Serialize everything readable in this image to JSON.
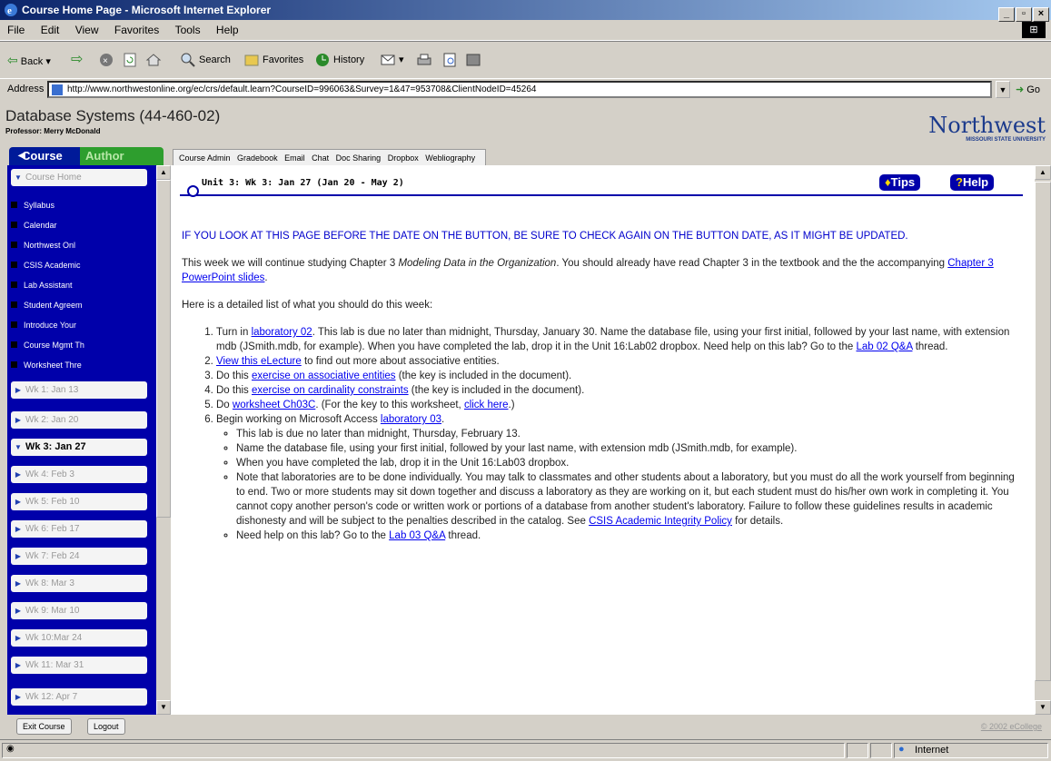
{
  "window": {
    "title": "Course Home Page - Microsoft Internet Explorer"
  },
  "menu": [
    "File",
    "Edit",
    "View",
    "Favorites",
    "Tools",
    "Help"
  ],
  "toolbar": {
    "back": "Back",
    "search": "Search",
    "favorites": "Favorites",
    "history": "History"
  },
  "address": {
    "label": "Address",
    "url": "http://www.northwestonline.org/ec/crs/default.learn?CourseID=996063&Survey=1&47=953708&ClientNodeID=45264",
    "go": "Go"
  },
  "course": {
    "title": "Database Systems (44-460-02)",
    "professor": "Professor: Merry McDonald"
  },
  "logo": {
    "name": "Northwest",
    "sub": "MISSOURI STATE UNIVERSITY"
  },
  "tabs": {
    "course": "Course",
    "author": "Author"
  },
  "top_tabs": [
    "Course Admin",
    "Gradebook",
    "Email",
    "Chat",
    "Doc Sharing",
    "Dropbox",
    "Webliography"
  ],
  "left_nav": {
    "home": "Course Home",
    "links": [
      "Syllabus",
      "Calendar",
      "Northwest Onl",
      "CSIS Academic",
      "Lab Assistant",
      "Student Agreem",
      "Introduce Your",
      "Course Mgmt Th",
      "Worksheet Thre"
    ],
    "weeks": [
      "Wk 1: Jan 13",
      "Wk 2: Jan 20",
      "Wk 3: Jan 27",
      "Wk 4: Feb 3",
      "Wk 5: Feb 10",
      "Wk 6: Feb 17",
      "Wk 7: Feb 24",
      "Wk 8: Mar 3",
      "Wk 9: Mar 10",
      "Wk 10:Mar 24",
      "Wk 11: Mar 31",
      "Wk 12: Apr 7"
    ],
    "active_week": "Wk 3: Jan 27"
  },
  "bottom": {
    "exit": "Exit Course",
    "logout": "Logout",
    "copyright": "© 2002 eCollege"
  },
  "status": {
    "zone": "Internet"
  },
  "content": {
    "unit_title": "Unit 3:  Wk 3: Jan 27 (Jan 20 - May 2)",
    "tips": "Tips",
    "help": "Help",
    "warning": "IF YOU LOOK AT THIS PAGE BEFORE THE DATE ON THE BUTTON, BE SURE TO CHECK AGAIN ON THE BUTTON DATE, AS IT MIGHT BE UPDATED.",
    "intro_a": "This week we will continue studying Chapter 3 ",
    "intro_book": "Modeling Data in the Organization",
    "intro_b": ". You should already have read Chapter 3 in the textbook and the the accompanying ",
    "intro_link": "Chapter 3 PowerPoint slides",
    "intro_c": ".",
    "list_intro": "Here is a detailed list of what you should do this week:",
    "i1_a": "Turn in ",
    "i1_link": "laboratory 02",
    "i1_b": ". This lab is due no later than midnight, Thursday, January 30. Name the database file, using your first initial, followed by your last name, with extension mdb (JSmith.mdb, for example). When you have completed the lab, drop it in the Unit 16:Lab02 dropbox.  Need help on this lab?  Go to the ",
    "i1_link2": "Lab 02 Q&A",
    "i1_c": " thread.",
    "i2_link": "View this eLecture",
    "i2_b": " to find out more about associative entities.",
    "i3_a": "Do this ",
    "i3_link": "exercise on associative entities",
    "i3_b": " (the key is included in the document).",
    "i4_a": "Do this ",
    "i4_link": "exercise on cardinality constraints",
    "i4_b": " (the key is included in the document).",
    "i5_a": "Do ",
    "i5_link": "worksheet Ch03C",
    "i5_b": ". (For the key to this worksheet, ",
    "i5_link2": "click here",
    "i5_c": ".)",
    "i6_a": "Begin working on Microsoft Access ",
    "i6_link": "laboratory 03",
    "i6_b": ".",
    "s1": "This lab is due no later than midnight, Thursday, February 13.",
    "s2": "Name the database file, using your first initial, followed by your last name, with extension mdb (JSmith.mdb, for example).",
    "s3": "When you have completed the lab, drop it in the Unit 16:Lab03 dropbox.",
    "s4_a": "Note that laboratories are to be done individually. You may talk to classmates and other students about a laboratory, but you must do all the work yourself from beginning to end. Two or more students may sit down together and discuss a laboratory as they are working on it, but each student must do his/her own work in completing it. You cannot copy another person's code or written work or portions of a database from another student's laboratory. Failure to follow these guidelines results in academic dishonesty and will be subject to the penalties described in the catalog. See ",
    "s4_link": "CSIS Academic Integrity Policy",
    "s4_b": " for details.",
    "s5_a": "Need help on this lab?  Go to the ",
    "s5_link": "Lab 03 Q&A",
    "s5_b": " thread."
  }
}
